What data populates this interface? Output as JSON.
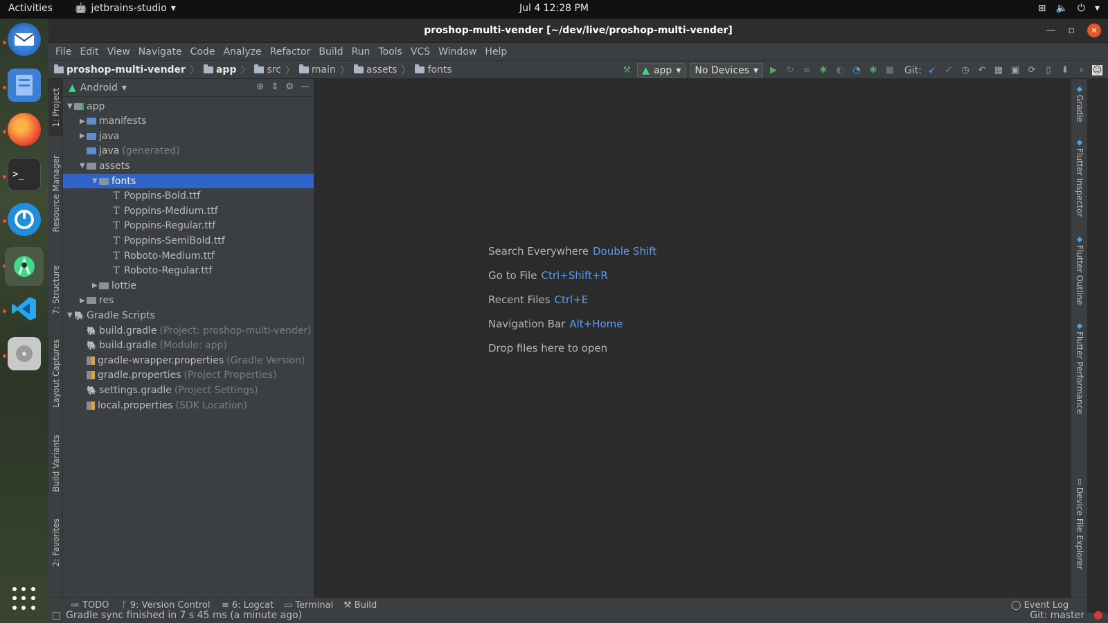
{
  "topbar": {
    "activities": "Activities",
    "app_name": "jetbrains-studio",
    "clock": "Jul 4  12:28 PM"
  },
  "window": {
    "title": "proshop-multi-vender [~/dev/live/proshop-multi-vender]"
  },
  "menu": [
    "File",
    "Edit",
    "View",
    "Navigate",
    "Code",
    "Analyze",
    "Refactor",
    "Build",
    "Run",
    "Tools",
    "VCS",
    "Window",
    "Help"
  ],
  "breadcrumbs": [
    "proshop-multi-vender",
    "app",
    "src",
    "main",
    "assets",
    "fonts"
  ],
  "toolbar": {
    "run_config": "app",
    "device": "No Devices",
    "git_label": "Git:"
  },
  "left_tabs": [
    "1: Project",
    "Resource Manager",
    "7: Structure",
    "Layout Captures",
    "Build Variants",
    "2: Favorites"
  ],
  "right_tabs": [
    "Gradle",
    "Flutter Inspector",
    "Flutter Outline",
    "Flutter Performance",
    "Device File Explorer"
  ],
  "project_panel": {
    "view": "Android",
    "tree": [
      {
        "label": "app",
        "extra": "",
        "level": 0,
        "arrow": "▼",
        "icon": "module"
      },
      {
        "label": "manifests",
        "extra": "",
        "level": 1,
        "arrow": "▶",
        "icon": "folder-blue"
      },
      {
        "label": "java",
        "extra": "",
        "level": 1,
        "arrow": "▶",
        "icon": "folder-blue"
      },
      {
        "label": "java",
        "extra": "(generated)",
        "level": 1,
        "arrow": "",
        "icon": "folder-blue"
      },
      {
        "label": "assets",
        "extra": "",
        "level": 1,
        "arrow": "▼",
        "icon": "folder"
      },
      {
        "label": "fonts",
        "extra": "",
        "level": 2,
        "arrow": "▼",
        "icon": "folder"
      },
      {
        "label": "Poppins-Bold.ttf",
        "extra": "",
        "level": 3,
        "arrow": "",
        "icon": "font"
      },
      {
        "label": "Poppins-Medium.ttf",
        "extra": "",
        "level": 3,
        "arrow": "",
        "icon": "font"
      },
      {
        "label": "Poppins-Regular.ttf",
        "extra": "",
        "level": 3,
        "arrow": "",
        "icon": "font"
      },
      {
        "label": "Poppins-SemiBold.ttf",
        "extra": "",
        "level": 3,
        "arrow": "",
        "icon": "font"
      },
      {
        "label": "Roboto-Medium.ttf",
        "extra": "",
        "level": 3,
        "arrow": "",
        "icon": "font"
      },
      {
        "label": "Roboto-Regular.ttf",
        "extra": "",
        "level": 3,
        "arrow": "",
        "icon": "font"
      },
      {
        "label": "lottie",
        "extra": "",
        "level": 2,
        "arrow": "▶",
        "icon": "folder"
      },
      {
        "label": "res",
        "extra": "",
        "level": 1,
        "arrow": "▶",
        "icon": "folder"
      },
      {
        "label": "Gradle Scripts",
        "extra": "",
        "level": 0,
        "arrow": "▼",
        "icon": "gradle"
      },
      {
        "label": "build.gradle",
        "extra": "(Project: proshop-multi-vender)",
        "level": 1,
        "arrow": "",
        "icon": "gradle"
      },
      {
        "label": "build.gradle",
        "extra": "(Module: app)",
        "level": 1,
        "arrow": "",
        "icon": "gradle"
      },
      {
        "label": "gradle-wrapper.properties",
        "extra": "(Gradle Version)",
        "level": 1,
        "arrow": "",
        "icon": "props"
      },
      {
        "label": "gradle.properties",
        "extra": "(Project Properties)",
        "level": 1,
        "arrow": "",
        "icon": "props"
      },
      {
        "label": "settings.gradle",
        "extra": "(Project Settings)",
        "level": 1,
        "arrow": "",
        "icon": "gradle"
      },
      {
        "label": "local.properties",
        "extra": "(SDK Location)",
        "level": 1,
        "arrow": "",
        "icon": "props"
      }
    ],
    "selected": "fonts"
  },
  "editor_hints": [
    {
      "text": "Search Everywhere",
      "key": "Double Shift"
    },
    {
      "text": "Go to File",
      "key": "Ctrl+Shift+R"
    },
    {
      "text": "Recent Files",
      "key": "Ctrl+E"
    },
    {
      "text": "Navigation Bar",
      "key": "Alt+Home"
    },
    {
      "text": "Drop files here to open",
      "key": ""
    }
  ],
  "bottom_tabs": {
    "todo": "TODO",
    "vcs": "9: Version Control",
    "logcat": "6: Logcat",
    "terminal": "Terminal",
    "build": "Build",
    "event_log": "Event Log"
  },
  "status": {
    "message": "Gradle sync finished in 7 s 45 ms (a minute ago)",
    "git_branch": "Git: master"
  },
  "colors": {
    "selection": "#2f65ca",
    "shortcut": "#589df6",
    "accent": "#e95420"
  }
}
